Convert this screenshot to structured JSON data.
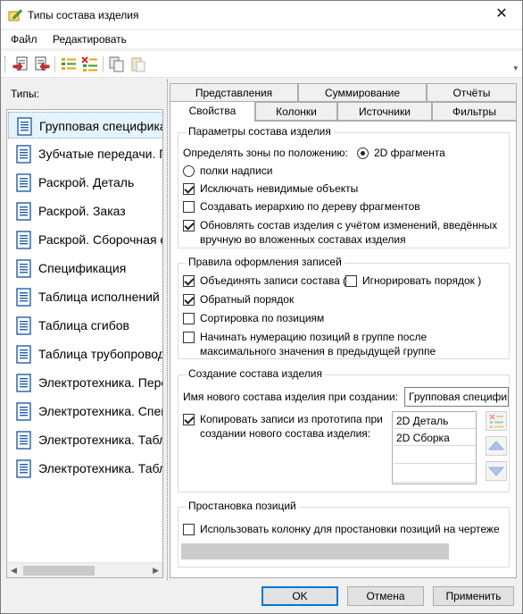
{
  "window": {
    "title": "Типы состава изделия",
    "close_glyph": "✕"
  },
  "menu": {
    "file": "Файл",
    "edit": "Редактировать"
  },
  "toolbar": {
    "overflow_glyph": "▾"
  },
  "types": {
    "label": "Типы:",
    "items": [
      "Групповая спецификация",
      "Зубчатые передачи. Параметры",
      "Раскрой. Деталь",
      "Раскрой. Заказ",
      "Раскрой. Сборочная единица",
      "Спецификация",
      "Таблица исполнений",
      "Таблица сгибов",
      "Таблица трубопроводов",
      "Электротехника. Перечень",
      "Электротехника. Спецификация",
      "Электротехника. Таблица",
      "Электротехника. Таблица"
    ],
    "selected_index": 0
  },
  "tabs": {
    "row1": [
      "Представления",
      "Суммирование",
      "Отчёты"
    ],
    "row2": [
      "Свойства",
      "Колонки",
      "Источники",
      "Фильтры"
    ],
    "active": "Свойства"
  },
  "params": {
    "title": "Параметры состава изделия",
    "zones_label": "Определять зоны по положению:",
    "radio_2d": "2D фрагмента",
    "radio_title": "полки надписи",
    "exclude_invisible": "Исключать невидимые объекты",
    "hierarchy": "Создавать иерархию по дереву фрагментов",
    "update_line1": "Обновлять состав изделия с учётом изменений, введённых",
    "update_line2": "вручную во вложенных составах изделия"
  },
  "rules": {
    "title": "Правила оформления записей",
    "merge": "Объединять записи состава (",
    "ignore_order": "Игнорировать порядок )",
    "reverse_order": "Обратный порядок",
    "sort_positions": "Сортировка по позициям",
    "numbering_line1": "Начинать нумерацию позиций в группе после",
    "numbering_line2": "максимального значения в предыдущей группе"
  },
  "creation": {
    "title": "Создание состава изделия",
    "name_label": "Имя нового состава изделия при создании:",
    "name_value": "Групповая спецификация",
    "copy_line1": "Копировать записи из прототипа при",
    "copy_line2": "создании нового состава изделия:",
    "prototypes": [
      "2D Деталь",
      "2D Сборка"
    ]
  },
  "positions": {
    "title": "Простановка позиций",
    "use_column": "Использовать колонку для простановки позиций на чертеже"
  },
  "buttons": {
    "ok": "OK",
    "cancel": "Отмена",
    "apply": "Применить"
  },
  "colors": {
    "accent": "#0078d7",
    "selection": "#e5f3fb",
    "icon_blue": "#1f5fa8"
  }
}
